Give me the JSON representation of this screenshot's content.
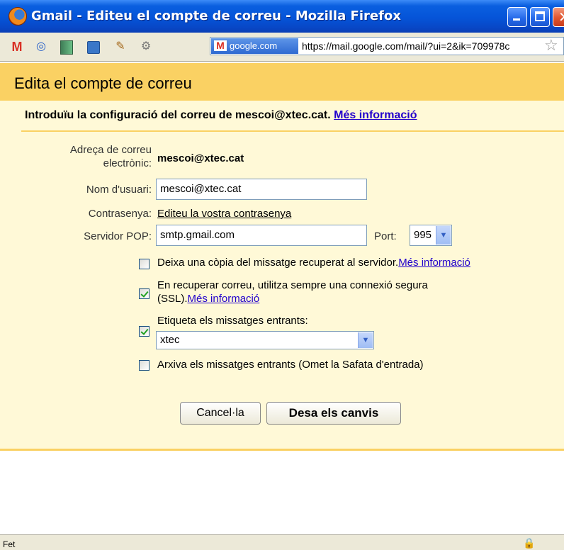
{
  "window": {
    "title": "Gmail - Editeu el compte de correu - Mozilla Firefox"
  },
  "navbar": {
    "site_badge": "google.com",
    "url": "https://mail.google.com/mail/?ui=2&ik=709978c"
  },
  "dialog": {
    "title": "Edita el compte de correu",
    "intro": "Introduïu la configuració del correu de mescoi@xtec.cat.",
    "intro_link": "Més informació",
    "email_label_line1": "Adreça de correu",
    "email_label_line2": "electrònic:",
    "email_value": "mescoi@xtec.cat",
    "username_label": "Nom d'usuari:",
    "username_value": "mescoi@xtec.cat",
    "password_label": "Contrasenya:",
    "password_link": "Editeu la vostra contrasenya",
    "pop_label": "Servidor POP:",
    "pop_value": "smtp.gmail.com",
    "port_label": "Port:",
    "port_value": "995",
    "option_leave_copy": "Deixa una còpia del missatge recuperat al servidor.",
    "option_leave_copy_link": "Més informació",
    "option_leave_copy_checked": false,
    "option_ssl_line1": "En recuperar correu, utilitza sempre una connexió segura",
    "option_ssl_line2": "(SSL).",
    "option_ssl_link": "Més informació",
    "option_ssl_checked": true,
    "option_label": "Etiqueta els missatges entrants:",
    "option_label_checked": true,
    "label_value": "xtec",
    "option_archive": "Arxiva els missatges entrants (Omet la Safata d'entrada)",
    "option_archive_checked": false,
    "cancel_button": "Cancel·la",
    "save_button": "Desa els canvis"
  },
  "status": {
    "text": "Fet"
  },
  "icons": [
    "gmail-icon",
    "compass-icon",
    "notebook-icon",
    "feed-icon",
    "tools-icon",
    "gear-icon",
    "star-icon",
    "lock-icon"
  ]
}
